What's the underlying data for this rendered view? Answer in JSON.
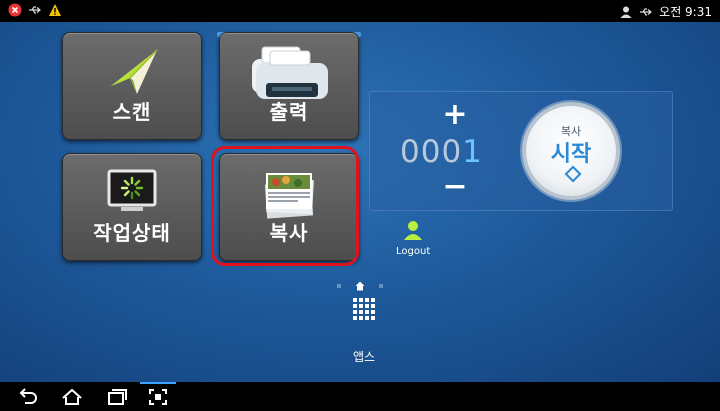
{
  "status_bar": {
    "time": "오전 9:31",
    "icons": [
      "error-icon",
      "usb-icon",
      "warning-icon",
      "user-icon",
      "usb-icon"
    ]
  },
  "tiles": [
    {
      "label": "스캔",
      "icon": "paper-plane-icon"
    },
    {
      "label": "출력",
      "icon": "printer-icon"
    },
    {
      "label": "작업상태",
      "icon": "monitor-loading-icon"
    },
    {
      "label": "복사",
      "icon": "document-stack-icon"
    }
  ],
  "copy_panel": {
    "plus_label": "+",
    "minus_label": "−",
    "quantity_prefix": "000",
    "quantity_last": "1",
    "start_small": "복사",
    "start_big": "시작"
  },
  "logout_label": "Logout",
  "apps_label": "앱스",
  "colors": {
    "highlight": "#e0121b",
    "accent": "#2a8ad8",
    "quantity_accent": "#6cc3ff"
  }
}
